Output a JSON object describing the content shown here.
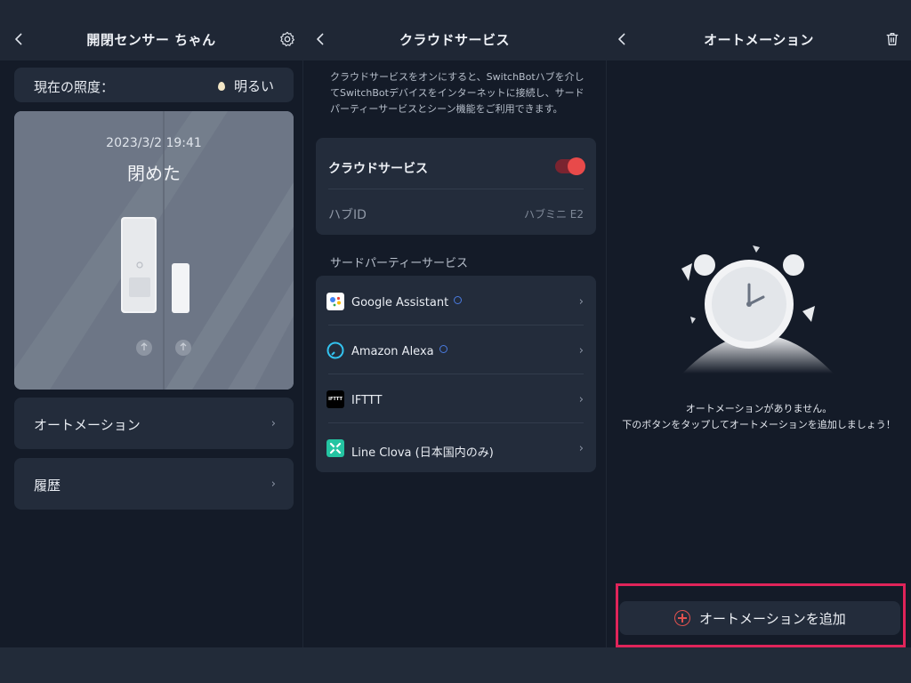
{
  "panel1": {
    "title": "開閉センサー ちゃん",
    "lux_label": "現在の照度：",
    "lux_value": "明るい",
    "timestamp": "2023/3/2 19:41",
    "state": "閉めた",
    "menu": [
      {
        "label": "オートメーション"
      },
      {
        "label": "履歴"
      }
    ]
  },
  "panel2": {
    "title": "クラウドサービス",
    "description": "クラウドサービスをオンにすると、SwitchBotハブを介してSwitchBotデバイスをインターネットに接続し、サードパーティーサービスとシーン機能をご利用できます。",
    "cloud_label": "クラウドサービス",
    "cloud_enabled": true,
    "hub_label": "ハブID",
    "hub_value": "ハブミニ E2",
    "third_party_title": "サードパーティーサービス",
    "services": [
      {
        "name": "Google Assistant",
        "icon": "google-assistant-icon",
        "info": true
      },
      {
        "name": "Amazon Alexa",
        "icon": "alexa-icon",
        "info": true
      },
      {
        "name": "IFTTT",
        "icon": "ifttt-icon",
        "info": false
      },
      {
        "name": "Line Clova (日本国内のみ)",
        "icon": "line-clova-icon",
        "info": false
      }
    ]
  },
  "panel3": {
    "title": "オートメーション",
    "empty_line1": "オートメーションがありません。",
    "empty_line2": "下のボタンをタップしてオートメーションを追加しましょう！",
    "add_button": "オートメーションを追加"
  },
  "icons": {
    "ifttt_text": "IFTTT"
  },
  "colors": {
    "accent": "#e84a4a",
    "highlight": "#e0245a",
    "background": "#141b28",
    "card": "#232c3b"
  }
}
